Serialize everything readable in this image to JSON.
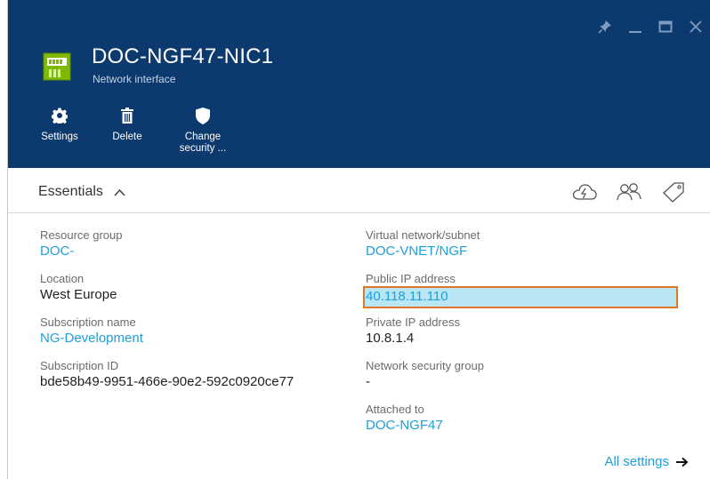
{
  "window": {
    "controls": [
      {
        "name": "pin-icon"
      },
      {
        "name": "minimize-icon"
      },
      {
        "name": "maximize-icon"
      },
      {
        "name": "close-icon"
      }
    ]
  },
  "header": {
    "title": "DOC-NGF47-NIC1",
    "subtitle": "Network interface",
    "icon": "network-interface-icon",
    "background_color": "#0d3a6e",
    "commands": [
      {
        "label": "Settings",
        "icon": "gear-icon"
      },
      {
        "label": "Delete",
        "icon": "trash-icon"
      },
      {
        "label": "Change\nsecurity ...",
        "icon": "shield-icon"
      }
    ]
  },
  "essentials": {
    "label": "Essentials",
    "toggle_icon": "chevron-up-icon",
    "bar_icons": [
      "cloud-icon",
      "users-icon",
      "tag-icon"
    ],
    "left": [
      {
        "label": "Resource group",
        "value": "DOC-",
        "link": true
      },
      {
        "label": "Location",
        "value": "West Europe",
        "link": false
      },
      {
        "label": "Subscription name",
        "value": "NG-Development",
        "link": true
      },
      {
        "label": "Subscription ID",
        "value": "bde58b49-9951-466e-90e2-592c0920ce77",
        "link": false
      }
    ],
    "right": [
      {
        "label": "Virtual network/subnet",
        "value": "DOC-VNET/NGF",
        "link": true
      },
      {
        "label": "Public IP address",
        "value": "40.118.11.110",
        "link": true,
        "highlighted": true
      },
      {
        "label": "Private IP address",
        "value": "10.8.1.4",
        "link": false
      },
      {
        "label": "Network security group",
        "value": "-",
        "link": false
      },
      {
        "label": "Attached to",
        "value": "DOC-NGF47",
        "link": true
      }
    ]
  },
  "footer": {
    "all_settings_label": "All settings",
    "arrow_icon": "arrow-right-icon"
  },
  "colors": {
    "link": "#1ea0dc",
    "highlight_fill": "#b8e6f5",
    "highlight_border": "#e07828"
  }
}
